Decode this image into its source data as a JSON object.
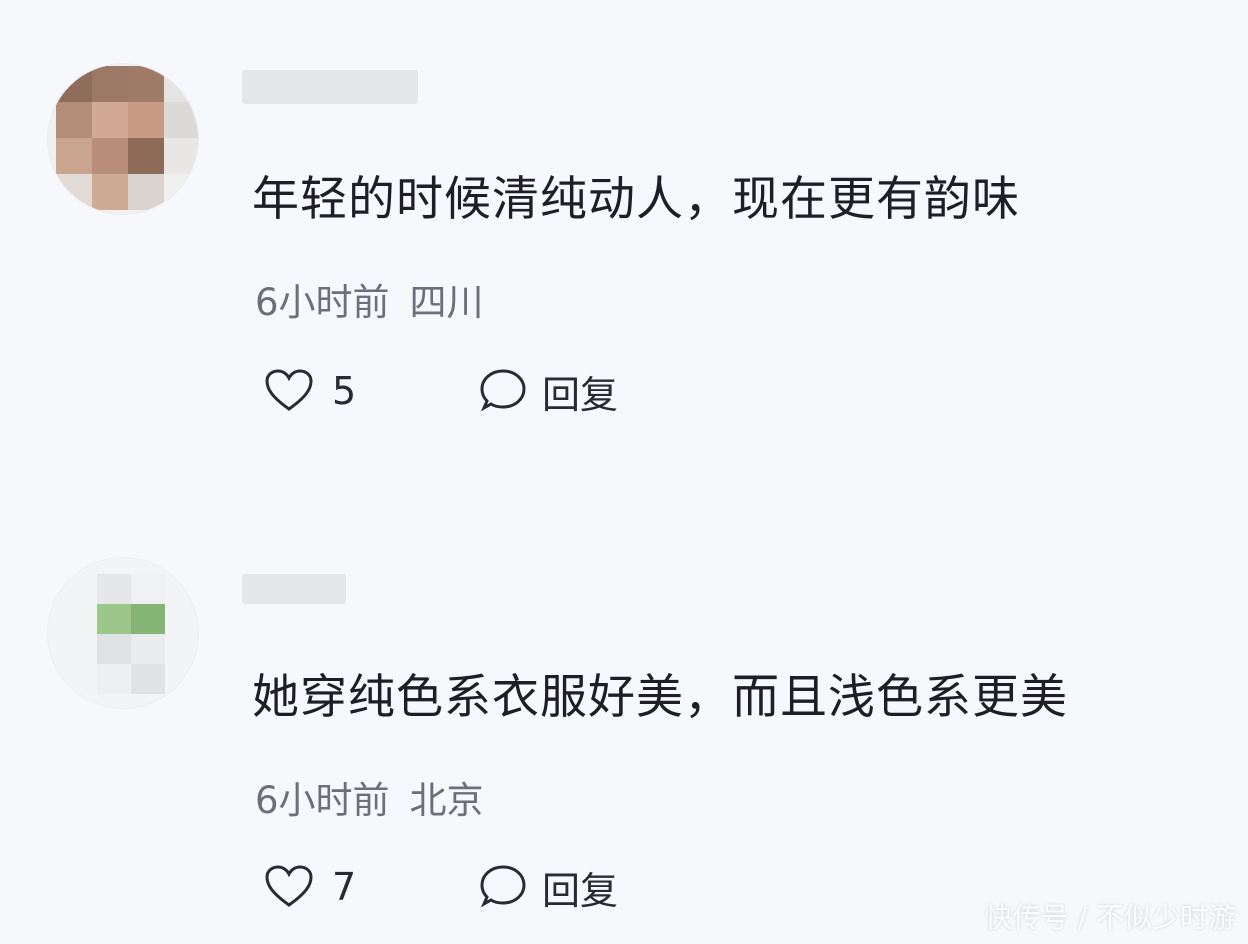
{
  "comments": [
    {
      "text": "年轻的时候清纯动人，现在更有韵味",
      "time": "6小时前",
      "location": "四川",
      "likes": "5",
      "reply_label": "回复",
      "avatar_colors": [
        "#8b6a57",
        "#a27864",
        "#c5a18b",
        "#9d7561",
        "#b48b77",
        "#dfd6d2",
        "#cfb09e",
        "#91705f"
      ]
    },
    {
      "text": "她穿纯色系衣服好美，而且浅色系更美",
      "time": "6小时前",
      "location": "北京",
      "likes": "7",
      "reply_label": "回复",
      "avatar_colors": [
        "#dcdedd",
        "#eef0f2",
        "#9ac58a",
        "#80af6f",
        "#e5e8ea",
        "#d7dbdf"
      ]
    }
  ],
  "watermark": "快传号 / 不似少时游",
  "icons": {
    "like": "heart-outline-icon",
    "reply": "speech-bubble-icon"
  }
}
